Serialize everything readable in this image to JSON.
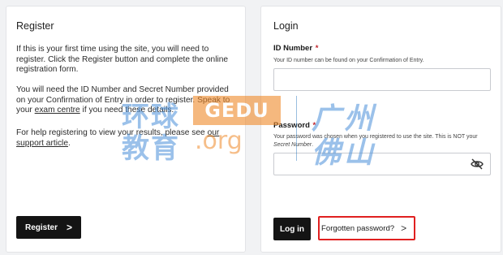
{
  "register": {
    "title": "Register",
    "p1": "If this is your first time using the site, you will need to register. Click the Register button and complete the online registration form.",
    "p2_before": "You will need the ID Number and Secret Number provided on your Confirmation of Entry in order to register. Speak to your ",
    "p2_link": "exam centre",
    "p2_after": " if you need these details.",
    "p3_before": "For help registering to view your results, please see ",
    "p3_link": "our support article",
    "p3_after": ".",
    "button_label": "Register",
    "button_chevron": ">"
  },
  "login": {
    "title": "Login",
    "id_label": "ID Number",
    "id_required": "*",
    "id_hint": "Your ID number can be found on your Confirmation of Entry.",
    "id_value": "",
    "password_label": "Password",
    "password_required": "*",
    "password_hint_before": "Your password was chosen when you registered to use the site. This is NOT your ",
    "password_hint_em": "Secret Number",
    "password_hint_after": ".",
    "password_value": "",
    "button_label": "Log in",
    "forgot_label": "Forgotten password?",
    "forgot_chevron": ">"
  },
  "watermark": {
    "cn_line1": "环球",
    "cn_line2": "教育",
    "brand": "GEDU",
    "domain": ".org",
    "city_line1": "广州",
    "city_line2": "佛山"
  },
  "icons": {
    "eye_slash": "eye-slash-icon",
    "chevron": "chevron-right-icon"
  },
  "colors": {
    "button_bg": "#141414",
    "required": "#c0232a",
    "highlight_border": "#e02020",
    "watermark_blue": "#4a90d9",
    "watermark_orange": "#f08a2a"
  }
}
